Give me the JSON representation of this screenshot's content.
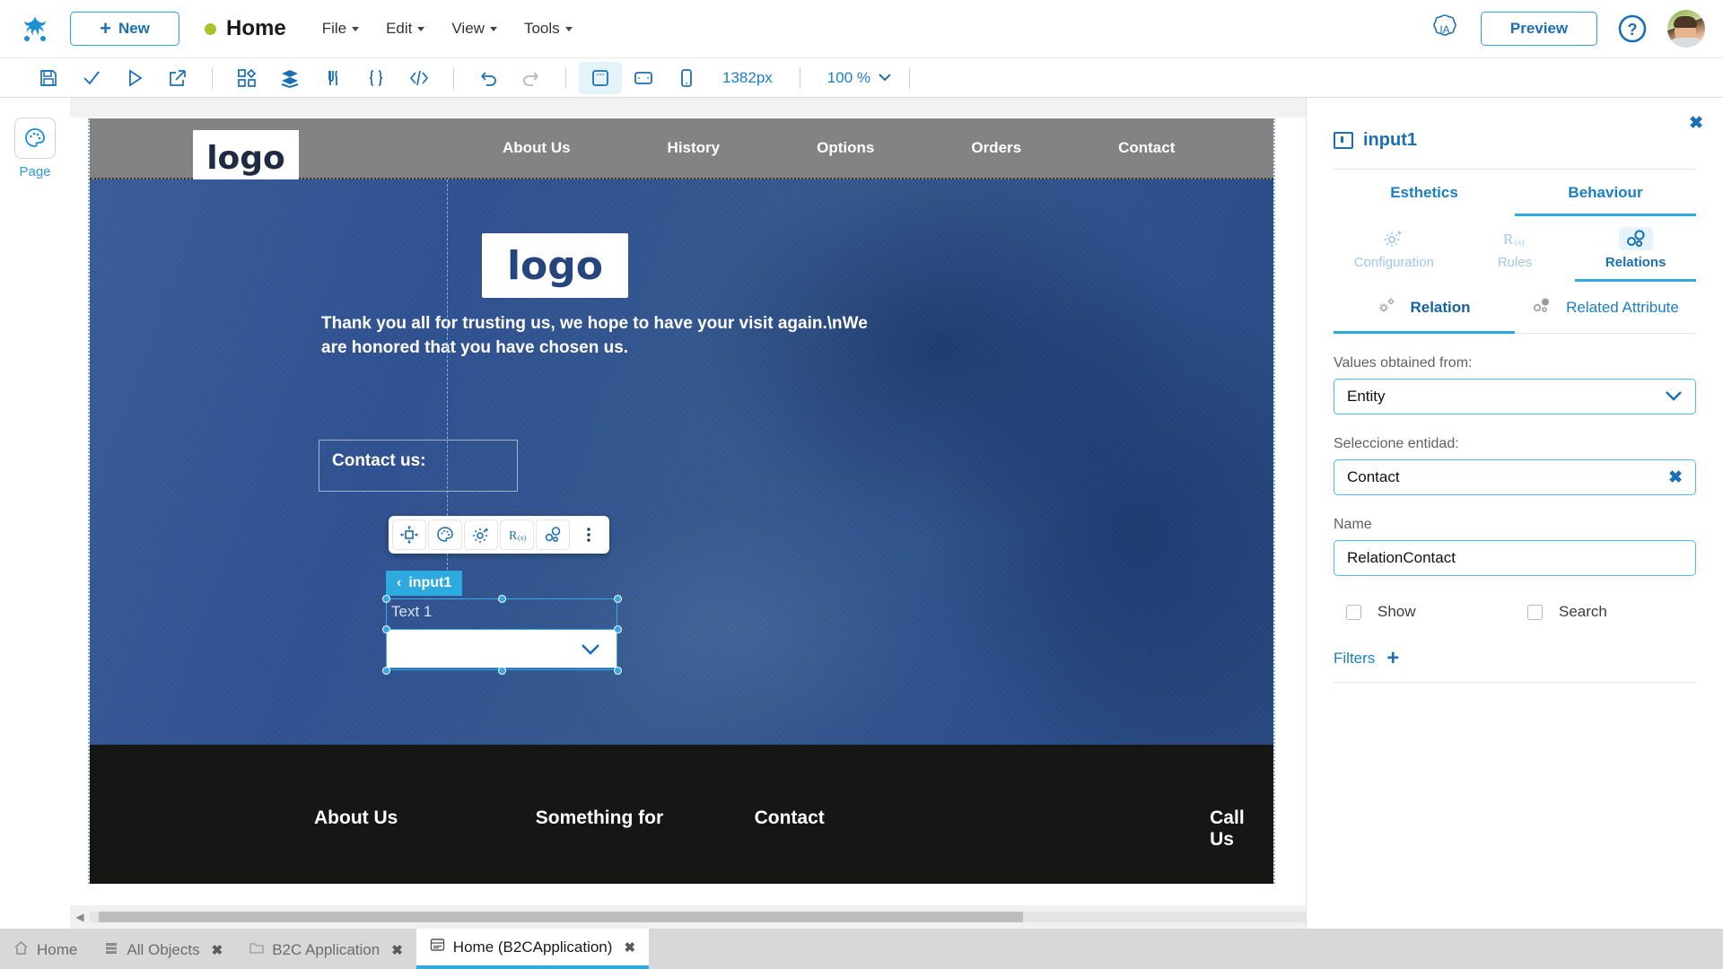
{
  "topbar": {
    "logo_icon": "frog-brand-icon",
    "new_button": "New",
    "new_plus": "+",
    "page_title": "Home",
    "menus": [
      "File",
      "Edit",
      "View",
      "Tools"
    ],
    "ia_badge": "IA",
    "preview_button": "Preview",
    "help_icon": "question-mark-icon",
    "avatar": "user-avatar"
  },
  "toolbar": {
    "icons": [
      "save-icon",
      "check-icon",
      "run-icon",
      "export-icon",
      "components-icon",
      "layers-icon",
      "data-icon",
      "braces-icon",
      "code-icon",
      "undo-icon",
      "redo-icon",
      "desktop-icon",
      "tablet-icon",
      "phone-icon"
    ],
    "width_value": "1382px",
    "zoom_value": "100 %"
  },
  "leftrail": {
    "icon": "palette-icon",
    "label": "Page"
  },
  "canvas": {
    "site_nav": {
      "logo": "logo",
      "items": [
        "About Us",
        "History",
        "Options",
        "Orders",
        "Contact"
      ]
    },
    "hero": {
      "logo": "logo",
      "paragraph": "Thank you all for trusting us, we hope to have your visit again.\\nWe are honored that you have chosen us.",
      "contact_label": "Contact us:"
    },
    "footer": {
      "items": [
        "About Us",
        "Something for",
        "Contact",
        "Call Us"
      ]
    },
    "selection": {
      "tag_label": "input1",
      "tag_chevron": "‹",
      "text_label": "Text 1",
      "float_toolbar_icons": [
        "move-icon",
        "palette-icon",
        "configuration-icon",
        "rules-icon",
        "relations-icon",
        "more-options-icon"
      ]
    }
  },
  "rightpanel": {
    "close_icon": "close-icon",
    "title": "input1",
    "title_icon": "input-field-icon",
    "tabs": [
      {
        "label": "Esthetics",
        "active": false
      },
      {
        "label": "Behaviour",
        "active": true
      }
    ],
    "subtabs": [
      {
        "label": "Configuration",
        "icon": "gear-sparkle-icon",
        "active": false
      },
      {
        "label": "Rules",
        "icon": "rules-rx-icon",
        "active": false
      },
      {
        "label": "Relations",
        "icon": "relations-nodes-icon",
        "active": true
      }
    ],
    "minitabs": [
      {
        "label": "Relation",
        "icon": "relation-gears-icon",
        "active": true
      },
      {
        "label": "Related Attribute",
        "icon": "related-attribute-icon",
        "active": false
      }
    ],
    "fields": {
      "values_from_label": "Values obtained from:",
      "values_from_value": "Entity",
      "entity_label": "Seleccione entidad:",
      "entity_value": "Contact",
      "name_label": "Name",
      "name_value": "RelationContact"
    },
    "checkboxes": [
      {
        "label": "Show",
        "checked": false
      },
      {
        "label": "Search",
        "checked": false
      }
    ],
    "filters_label": "Filters",
    "filters_plus": "+"
  },
  "bottom": {
    "tabs": [
      {
        "label": "Home",
        "icon": "home-icon",
        "closable": false,
        "active": false
      },
      {
        "label": "All Objects",
        "icon": "list-icon",
        "closable": true,
        "active": false
      },
      {
        "label": "B2C Application",
        "icon": "folder-icon",
        "closable": true,
        "active": false
      },
      {
        "label": "Home (B2CApplication)",
        "icon": "page-icon",
        "closable": true,
        "active": true
      }
    ],
    "close_glyph": "✖",
    "scroll_left": "◀",
    "scroll_right": "▶"
  },
  "colors": {
    "accent": "#2daae0",
    "brand_blue": "#1b6fb5",
    "status_dot": "#a9c32a",
    "hero_blue": "#2f5190"
  }
}
